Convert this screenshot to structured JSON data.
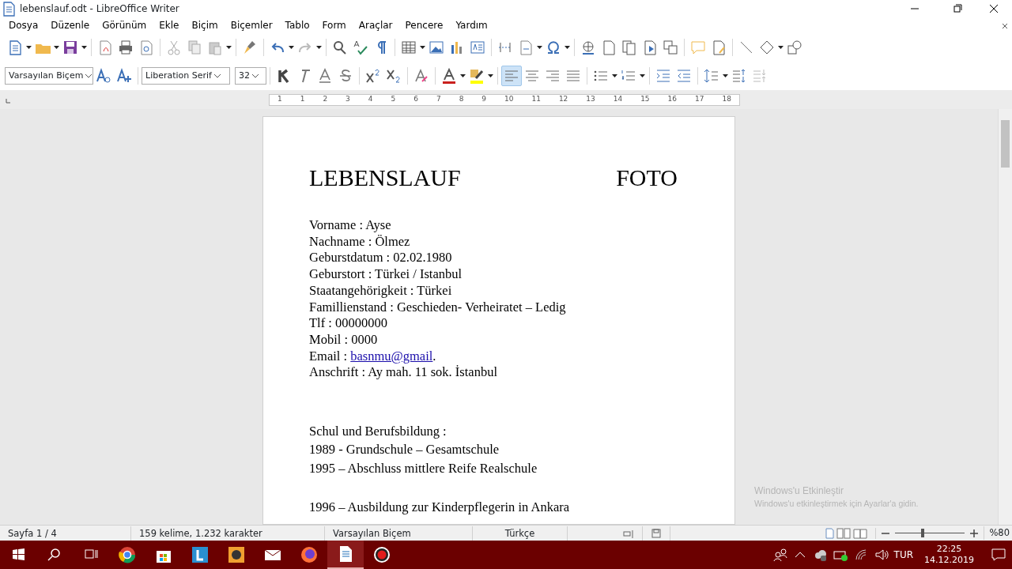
{
  "window": {
    "title": "lebenslauf.odt - LibreOffice Writer"
  },
  "menu": [
    "Dosya",
    "Düzenle",
    "Görünüm",
    "Ekle",
    "Biçim",
    "Biçemler",
    "Tablo",
    "Form",
    "Araçlar",
    "Pencere",
    "Yardım"
  ],
  "formatting": {
    "paragraph_style": "Varsayılan Biçem",
    "font_name": "Liberation Serif",
    "font_size": "32"
  },
  "alignment": [
    {
      "selected": true
    },
    {
      "selected": false
    },
    {
      "selected": false
    },
    {
      "selected": false
    }
  ],
  "ruler": {
    "labels": [
      "1",
      "1",
      "2",
      "3",
      "4",
      "5",
      "6",
      "7",
      "8",
      "9",
      "10",
      "11",
      "12",
      "13",
      "14",
      "15",
      "16",
      "17",
      "18"
    ]
  },
  "document": {
    "title": "LEBENSLAUF",
    "photo_label": "FOTO",
    "groups": [
      {
        "kind": "personal",
        "lines": [
          {
            "kind": "text",
            "text": "Vorname : Ayse"
          },
          {
            "kind": "text",
            "text": "Nachname : Ölmez"
          },
          {
            "kind": "text",
            "text": "Geburstdatum : 02.02.1980"
          },
          {
            "kind": "text",
            "text": "Geburstort : Türkei  / Istanbul"
          },
          {
            "kind": "text",
            "text": "Staatangehörigkeit : Türkei"
          },
          {
            "kind": "text",
            "text": "Famillienstand : Geschieden- Verheiratet – Ledig"
          },
          {
            "kind": "text",
            "text": "Tlf : 00000000"
          },
          {
            "kind": "text",
            "text": "Mobil : 0000"
          },
          {
            "kind": "link",
            "prefix": "Email : ",
            "link": "basnmu@gmail",
            "suffix": "."
          },
          {
            "kind": "text",
            "text": "Anschrift : Ay mah. 11 sok. İstanbul"
          }
        ]
      },
      {
        "kind": "education",
        "lines": [
          {
            "kind": "text",
            "text": "Schul und Berufsbildung :"
          },
          {
            "kind": "text",
            "text": "1989 -  Grundschule – Gesamtschule"
          },
          {
            "kind": "text",
            "text": "1995 – Abschluss mittlere Reife Realschule"
          }
        ]
      },
      {
        "kind": "education",
        "lines": [
          {
            "kind": "text",
            "text": "1996 – Ausbildung zur Kinderpflegerin in Ankara"
          }
        ]
      }
    ]
  },
  "activation": {
    "title": "Windows'u Etkinleştir",
    "message": "Windows'u etkinleştirmek için Ayarlar'a gidin."
  },
  "status_bar": {
    "page": "Sayfa 1 / 4",
    "words": "159 kelime, 1.232 karakter",
    "style": "Varsayılan Biçem",
    "language": "Türkçe",
    "zoom": {
      "level": 0.37,
      "reading": "%80"
    }
  },
  "taskbar": {
    "apps": [
      {
        "selected": false
      },
      {
        "selected": false
      },
      {
        "selected": false
      },
      {
        "selected": false
      },
      {
        "selected": false
      },
      {
        "selected": false
      },
      {
        "selected": true
      },
      {
        "selected": false
      }
    ],
    "language": "TUR",
    "time": "22:25",
    "date": "14.12.2019"
  }
}
